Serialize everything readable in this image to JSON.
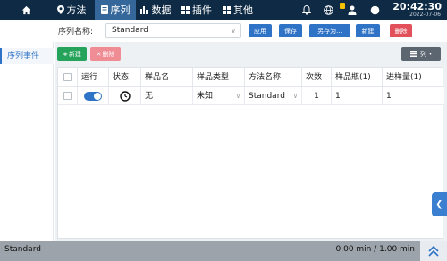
{
  "nav": {
    "items": [
      {
        "label": "方法",
        "icon": "location-icon"
      },
      {
        "label": "序列",
        "icon": "document-icon"
      },
      {
        "label": "数据",
        "icon": "bar-chart-icon"
      },
      {
        "label": "插件",
        "icon": "grid-icon"
      },
      {
        "label": "其他",
        "icon": "apps-icon"
      }
    ],
    "active": "序列",
    "time": "20:42:30",
    "date": "2022-07-06"
  },
  "toolbar": {
    "sequence_label": "序列名称:",
    "sequence_value": "Standard",
    "apply_label": "应用",
    "save_label": "保存",
    "save_as_label": "另存为...",
    "new_label": "新建",
    "delete_label": "删除"
  },
  "sidebar": {
    "items": [
      {
        "label": "序列事件"
      }
    ]
  },
  "content": {
    "add_label": "新建",
    "remove_label": "删除",
    "columns_label": "列"
  },
  "table": {
    "headers": [
      "",
      "运行",
      "状态",
      "样品名",
      "样品类型",
      "方法名称",
      "次数",
      "样品瓶(1)",
      "进样量(1)"
    ],
    "rows": [
      {
        "sample_name": "无",
        "sample_type": "未知",
        "method": "Standard",
        "count": "1",
        "vial": "1",
        "injection": "1"
      }
    ]
  },
  "status": {
    "left": "Standard",
    "right": "0.00 min / 1.00 min"
  },
  "colors": {
    "nav_bg": "#0e2a44",
    "accent": "#2f73c6",
    "danger": "#e2505a",
    "success": "#25a35a"
  }
}
